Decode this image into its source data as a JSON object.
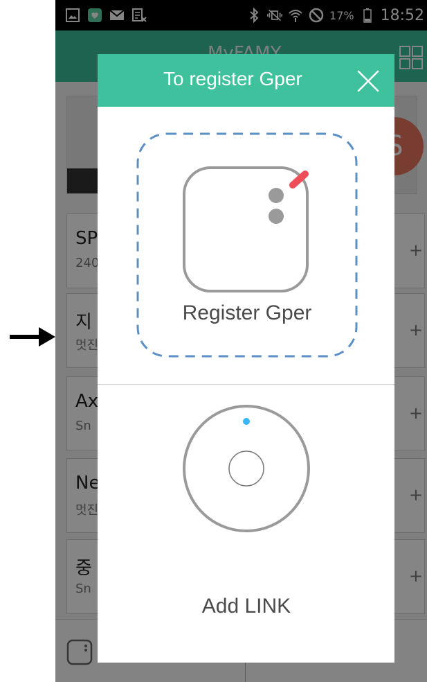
{
  "status_bar": {
    "battery": "17%",
    "time": "18:52"
  },
  "app_bar": {
    "title": "MyFAMY"
  },
  "hero": {
    "initial": "S"
  },
  "list": [
    {
      "title": "SP",
      "subtitle": "240"
    },
    {
      "title": "지",
      "subtitle": "멋진"
    },
    {
      "title": "Ax",
      "subtitle": "Sn"
    },
    {
      "title": "Ne",
      "subtitle": "멋진"
    },
    {
      "title": "중",
      "subtitle": "Sn"
    }
  ],
  "modal": {
    "title": "To register Gper",
    "register_gper_label": "Register Gper",
    "add_link_label": "Add LINK"
  },
  "colors": {
    "header_green": "#3fc19d",
    "accent_red": "#ef4d57",
    "link_dot_blue": "#38b6f5",
    "dashed_border_blue": "#5b8fc6"
  }
}
